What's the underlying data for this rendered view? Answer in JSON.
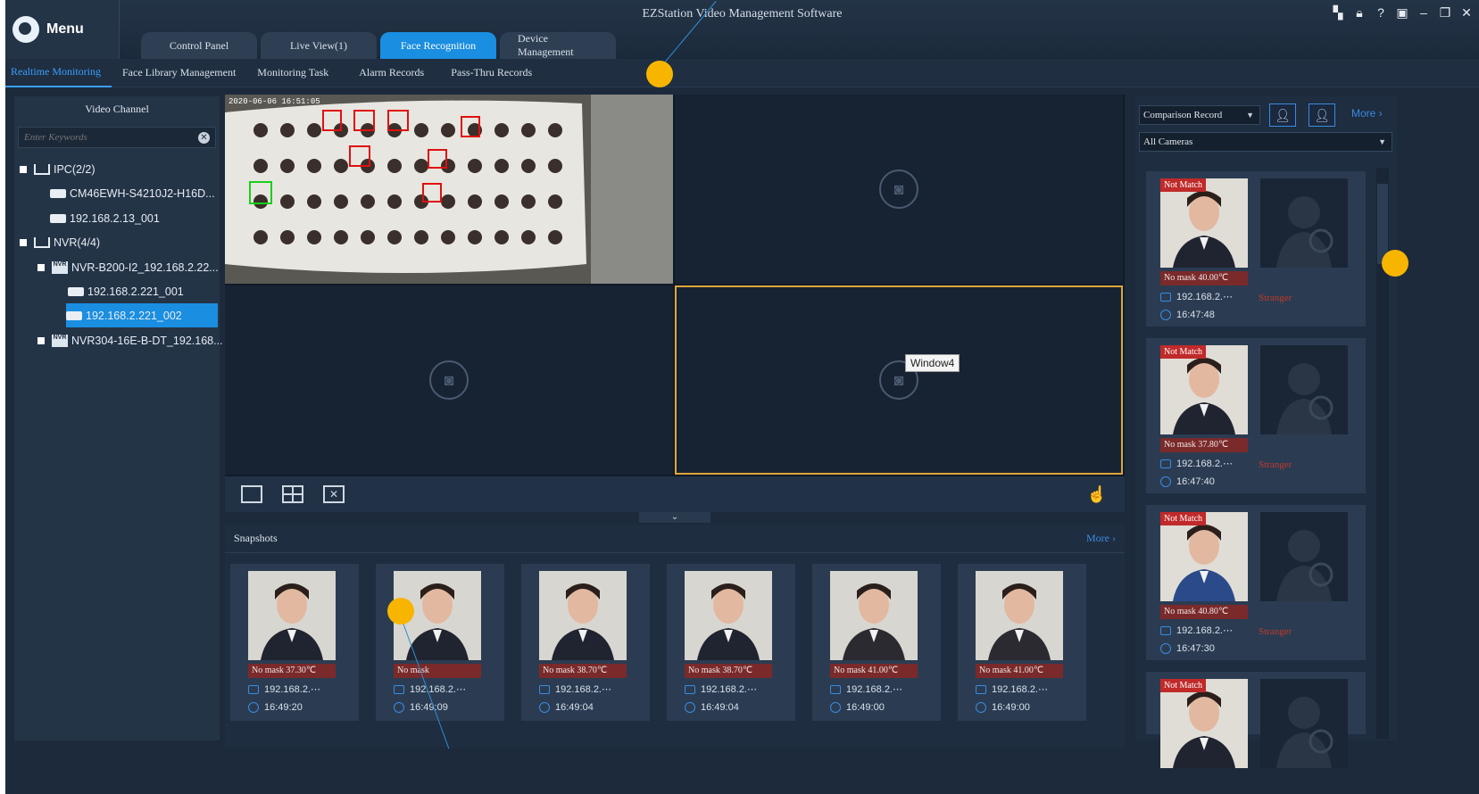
{
  "app": {
    "title": "EZStation Video Management Software",
    "menu_label": "Menu"
  },
  "tabs": [
    {
      "label": "Control Panel"
    },
    {
      "label": "Live View(1)"
    },
    {
      "label": "Face Recognition"
    },
    {
      "label": "Device Management"
    }
  ],
  "subnav": [
    {
      "label": "Realtime Monitoring"
    },
    {
      "label": "Face Library Management"
    },
    {
      "label": "Monitoring Task"
    },
    {
      "label": "Alarm Records"
    },
    {
      "label": "Pass-Thru Records"
    }
  ],
  "left": {
    "header": "Video Channel",
    "search_placeholder": "Enter Keywords",
    "tree": [
      {
        "label": "IPC(2/2)"
      },
      {
        "label": "CM46EWH-S4210J2-H16D..."
      },
      {
        "label": "192.168.2.13_001"
      },
      {
        "label": "NVR(4/4)"
      },
      {
        "label": "NVR-B200-I2_192.168.2.22..."
      },
      {
        "label": "192.168.2.221_001"
      },
      {
        "label": "192.168.2.221_002"
      },
      {
        "label": "NVR304-16E-B-DT_192.168..."
      }
    ]
  },
  "video": {
    "feed_timestamp": "2020-06-06 16:51:05",
    "tooltip": "Window4"
  },
  "snapshots": {
    "title": "Snapshots",
    "more": "More",
    "items": [
      {
        "tag": "No mask  37.30℃",
        "ip": "192.168.2.⋯",
        "time": "16:49:20"
      },
      {
        "tag": "No mask",
        "ip": "192.168.2.⋯",
        "time": "16:49:09"
      },
      {
        "tag": "No mask  38.70℃",
        "ip": "192.168.2.⋯",
        "time": "16:49:04"
      },
      {
        "tag": "No mask  38.70℃",
        "ip": "192.168.2.⋯",
        "time": "16:49:04"
      },
      {
        "tag": "No mask  41.00℃",
        "ip": "192.168.2.⋯",
        "time": "16:49:00"
      },
      {
        "tag": "No mask  41.00℃",
        "ip": "192.168.2.⋯",
        "time": "16:49:00"
      }
    ]
  },
  "right": {
    "record_select": "Comparison Record",
    "camera_select": "All Cameras",
    "more": "More",
    "records": [
      {
        "status": "Not Match",
        "tag": "No mask  40.00℃",
        "ip": "192.168.2.⋯",
        "result": "Stranger",
        "time": "16:47:48"
      },
      {
        "status": "Not Match",
        "tag": "No mask  37.80℃",
        "ip": "192.168.2.⋯",
        "result": "Stranger",
        "time": "16:47:40"
      },
      {
        "status": "Not Match",
        "tag": "No mask  40.80℃",
        "ip": "192.168.2.⋯",
        "result": "Stranger",
        "time": "16:47:30"
      },
      {
        "status": "Not Match"
      }
    ]
  }
}
